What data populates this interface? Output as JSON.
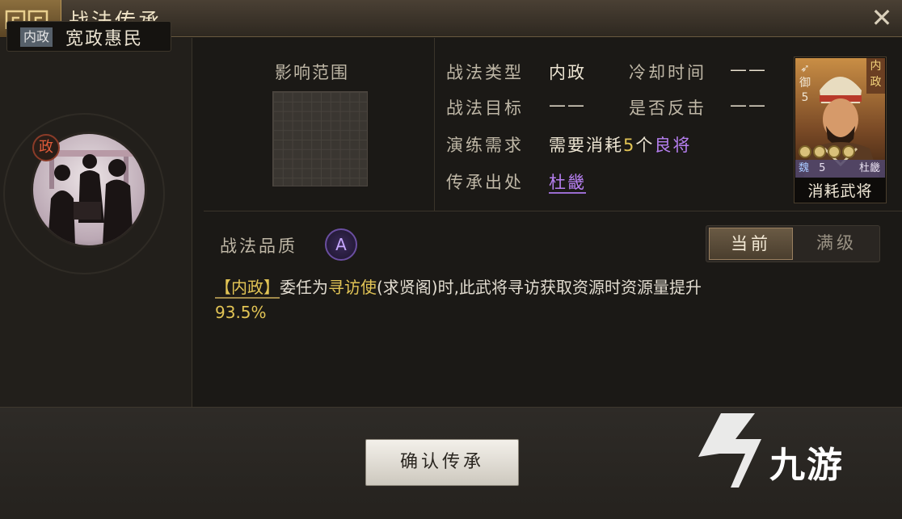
{
  "window": {
    "title": "战法传承",
    "close_label": "✕"
  },
  "skill": {
    "category_tag": "内政",
    "name": "宽政惠民",
    "emblem_badge": "政"
  },
  "range": {
    "title": "影响范围"
  },
  "info": {
    "type_label": "战法类型",
    "type_value": "内政",
    "cooldown_label": "冷却时间",
    "cooldown_value": "——",
    "target_label": "战法目标",
    "target_value": "——",
    "counter_label": "是否反击",
    "counter_value": "——",
    "drill_label": "演练需求",
    "drill_value_prefix": "需要消耗",
    "drill_count": "5",
    "drill_unit": "个",
    "drill_quality": "良将",
    "source_label": "传承出处",
    "source_value": "杜畿"
  },
  "general_card": {
    "faction_tag": "内政",
    "troop_icon": "bow-icon",
    "troop_type": "御",
    "cost": "5",
    "coins": 4,
    "kingdom": "魏",
    "level": "5",
    "name": "杜畿",
    "caption": "消耗武将"
  },
  "quality": {
    "label": "战法品质",
    "grade": "A",
    "toggle_current": "当前",
    "toggle_max": "满级"
  },
  "description": {
    "tag": "【内政】",
    "text_1": "委任为",
    "highlight": "寻访使",
    "text_2": "(求贤阁)时,此武将寻访获取资源时资源量提升",
    "value": "93.5%"
  },
  "footer": {
    "confirm_label": "确认传承"
  },
  "watermark": {
    "text": "九游"
  },
  "colors": {
    "accent_yellow": "#e2c455",
    "accent_purple": "#b67ff0"
  }
}
